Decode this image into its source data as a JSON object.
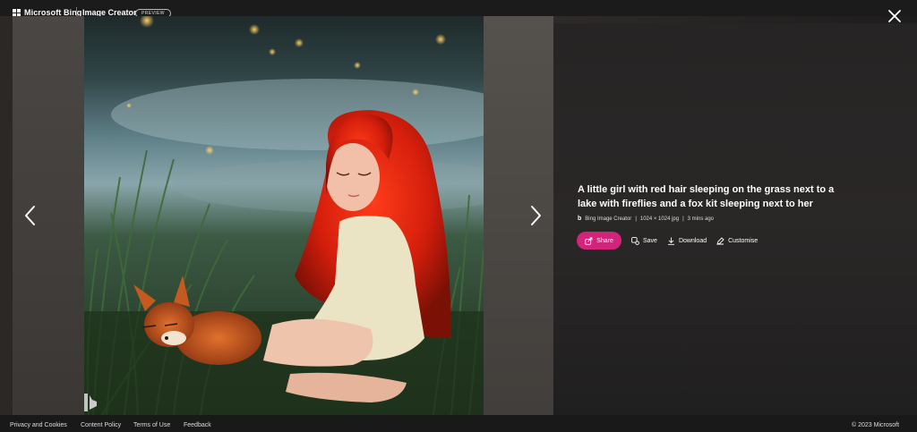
{
  "header": {
    "brand": "Microsoft Bing",
    "app_title": "Image Creator",
    "badge": "PREVIEW"
  },
  "viewer": {
    "image_alt": "A little girl with red hair sleeping on the grass next to a lake with fireflies and a fox kit sleeping next to her",
    "watermark_icon": "bing-logo-icon"
  },
  "details": {
    "prompt": "A little girl with red hair sleeping on the grass next to a lake with fireflies and a fox kit sleeping next to her",
    "source": "Bing Image Creator",
    "dimensions": "1024 × 1024 jpg",
    "time": "3 mins ago",
    "separator": "|"
  },
  "actions": {
    "share": "Share",
    "save": "Save",
    "download": "Download",
    "customise": "Customise"
  },
  "footer": {
    "links": [
      "Privacy and Cookies",
      "Content Policy",
      "Terms of Use",
      "Feedback"
    ],
    "copyright": "© 2023 Microsoft"
  },
  "colors": {
    "accent": "#d1247a",
    "background": "#1b1a1a"
  },
  "icons": [
    "microsoft-logo-icon",
    "close-icon",
    "chevron-left-icon",
    "chevron-right-icon",
    "share-icon",
    "save-icon",
    "download-icon",
    "customise-icon",
    "bing-logo-icon"
  ]
}
